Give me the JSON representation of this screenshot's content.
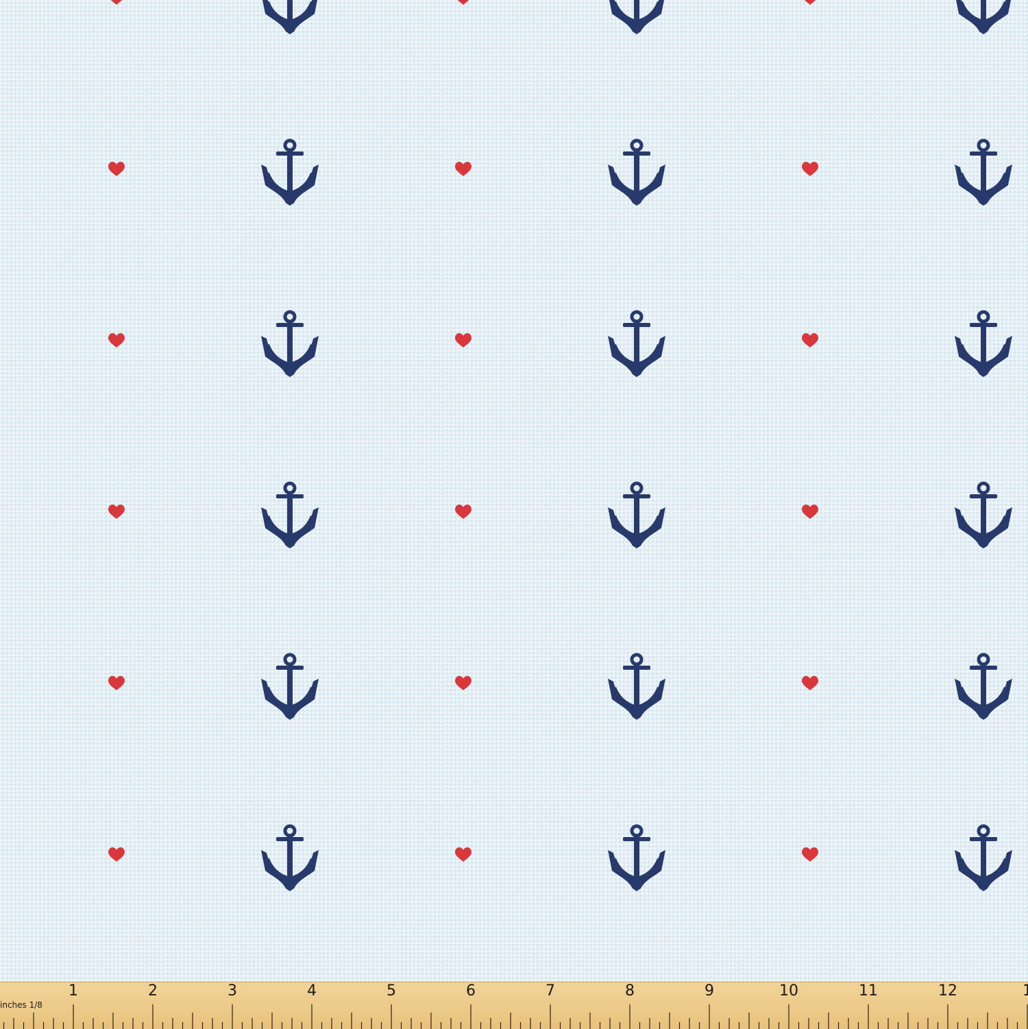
{
  "pattern": {
    "description_colors": {
      "background": "#e4eef5",
      "anchor": "#273a6b",
      "heart": "#d8373c"
    },
    "motifs": [
      "anchor-icon",
      "heart-icon"
    ]
  },
  "ruler": {
    "numbers": [
      "1",
      "2",
      "3",
      "4",
      "5",
      "6",
      "7",
      "8",
      "9",
      "10",
      "11",
      "12",
      "1"
    ],
    "units_label": "inches 1/8"
  }
}
